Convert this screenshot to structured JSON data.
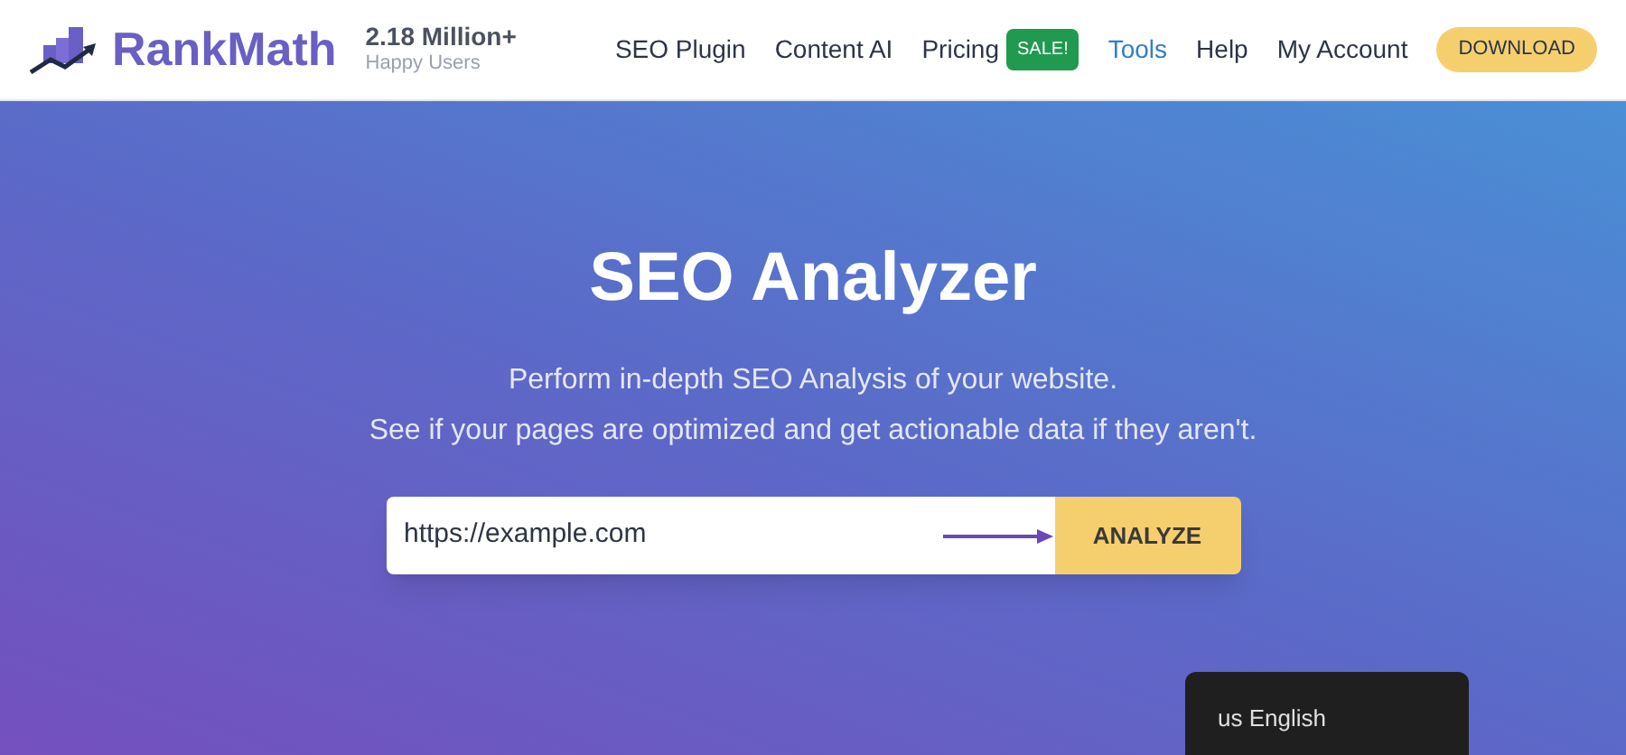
{
  "header": {
    "logo": "RankMath",
    "users_count": "2.18 Million+",
    "users_caption": "Happy Users",
    "nav": [
      {
        "label": "SEO Plugin",
        "selected": false
      },
      {
        "label": "Content AI",
        "selected": false
      },
      {
        "label": "Pricing",
        "selected": false,
        "badge": "SALE!"
      },
      {
        "label": "Tools",
        "selected": true
      },
      {
        "label": "Help",
        "selected": false
      },
      {
        "label": "My Account",
        "selected": false
      }
    ],
    "download": "DOWNLOAD"
  },
  "hero": {
    "title": "SEO Analyzer",
    "lines": [
      "Perform in-depth SEO Analysis of your website.",
      "See if your pages are optimized and get actionable data if they aren't."
    ],
    "url_field": {
      "value": "https://example.com"
    },
    "analyze": "ANALYZE"
  },
  "language_popup": {
    "label": "us English"
  }
}
